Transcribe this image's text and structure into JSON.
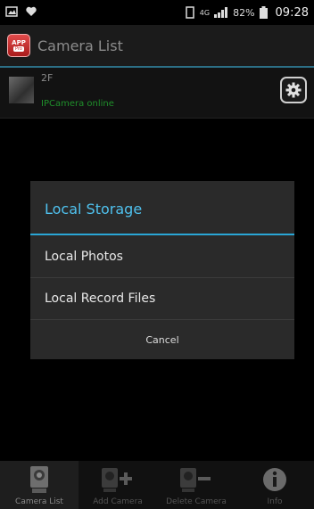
{
  "status_bar": {
    "battery_percent": "82%",
    "network": "4G",
    "time": "09:28"
  },
  "app_bar": {
    "icon_top": "APP",
    "icon_bottom": "Pro",
    "title": "Camera List"
  },
  "camera": {
    "name": "2F",
    "status": "IPCamera online"
  },
  "dialog": {
    "title": "Local Storage",
    "items": [
      {
        "label": "Local Photos"
      },
      {
        "label": "Local Record Files"
      }
    ],
    "cancel_label": "Cancel"
  },
  "tabs": [
    {
      "label": "Camera List",
      "icon": "camera-icon",
      "active": true
    },
    {
      "label": "Add Camera",
      "icon": "add-camera-icon",
      "active": false
    },
    {
      "label": "Delete Camera",
      "icon": "delete-camera-icon",
      "active": false
    },
    {
      "label": "Info",
      "icon": "info-icon",
      "active": false
    }
  ],
  "colors": {
    "accent": "#4fc1ee",
    "divider": "#2aa6d6",
    "online": "#1f8f2b"
  }
}
